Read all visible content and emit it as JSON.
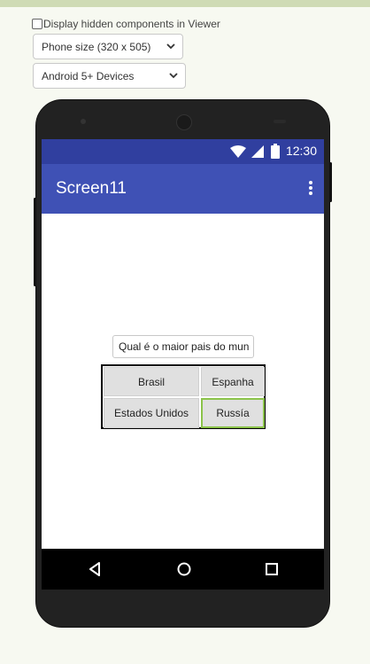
{
  "viewer": {
    "hidden_components_label": "Display hidden components in Viewer",
    "phone_size_select": "Phone size (320 x 505)",
    "device_select": "Android 5+ Devices"
  },
  "phone": {
    "status_time": "12:30",
    "app_title": "Screen11",
    "question_text": "Qual é o maior pais do mun",
    "options": [
      "Brasil",
      "Espanha",
      "Estados Unidos",
      "Russia"
    ],
    "options_display": [
      "Brasil",
      "Espanha",
      "Estados Unidos",
      "Russía"
    ],
    "selected_option": "Russía"
  },
  "colors": {
    "status_bar": "#303f9f",
    "app_bar": "#3f51b5",
    "selected_border": "#8bc34a"
  },
  "icons": [
    "wifi-icon",
    "signal-icon",
    "battery-icon",
    "more-vert-icon",
    "back-icon",
    "home-icon",
    "recent-apps-icon",
    "chevron-down-icon"
  ]
}
